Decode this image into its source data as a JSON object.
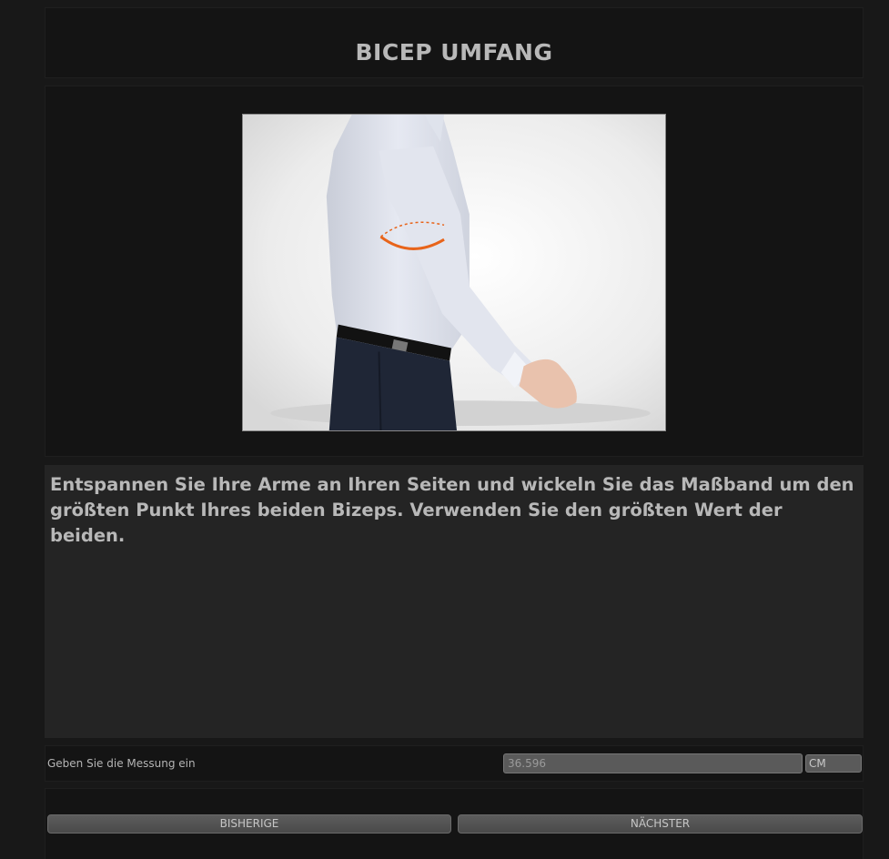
{
  "header": {
    "title": "BICEP UMFANG"
  },
  "illustration": {
    "description_icon": "bicep-measurement-photo"
  },
  "instruction": {
    "text": "Entspannen Sie Ihre Arme an Ihren Seiten und wickeln Sie das Maßband um den größten Punkt Ihres beiden Bizeps. Verwenden Sie den größten Wert der beiden."
  },
  "measurement": {
    "label": "Geben Sie die Messung ein",
    "value": "36.596",
    "unit": "CM"
  },
  "navigation": {
    "previous_label": "BISHERIGE",
    "next_label": "NÄCHSTER"
  },
  "colors": {
    "background": "#181818",
    "panel": "#141414",
    "instruction_bg": "#242424",
    "button": "#555555",
    "measure_line": "#e8641a"
  }
}
